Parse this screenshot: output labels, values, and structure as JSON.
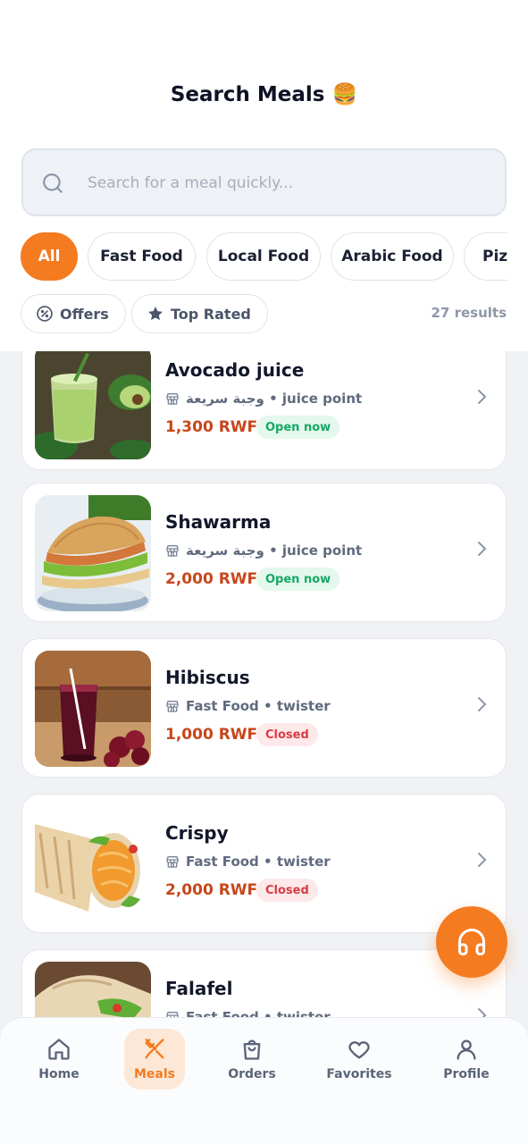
{
  "header": {
    "title": "Search Meals 🍔"
  },
  "search": {
    "placeholder": "Search for a meal quickly..."
  },
  "categories": [
    "All",
    "Fast Food",
    "Local Food",
    "Arabic Food",
    "Pizza"
  ],
  "filters": {
    "offers": "Offers",
    "top_rated": "Top Rated"
  },
  "results_count": "27 results",
  "meals": [
    {
      "name": "Avocado juice",
      "meta": "وجبة سريعة • juice point",
      "price": "1,300 RWF",
      "status": "Open now"
    },
    {
      "name": "Shawarma",
      "meta": "وجبة سريعة • juice point",
      "price": "2,000 RWF",
      "status": "Open now"
    },
    {
      "name": "Hibiscus",
      "meta": "Fast Food • twister",
      "price": "1,000 RWF",
      "status": "Closed"
    },
    {
      "name": "Crispy",
      "meta": "Fast Food • twister",
      "price": "2,000 RWF",
      "status": "Closed"
    },
    {
      "name": "Falafel",
      "meta": "Fast Food • twister",
      "price": "",
      "status": ""
    }
  ],
  "nav": {
    "home": "Home",
    "meals": "Meals",
    "orders": "Orders",
    "favorites": "Favorites",
    "profile": "Profile"
  },
  "colors": {
    "accent": "#f47b20",
    "price": "#c7461a",
    "open": "#17a865",
    "closed": "#da3b45"
  }
}
